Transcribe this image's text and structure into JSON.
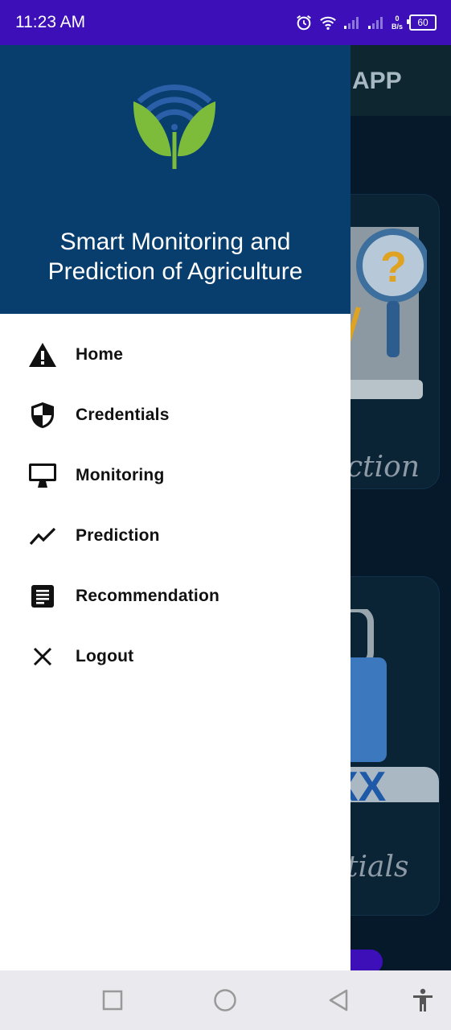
{
  "status_bar": {
    "time": "11:23 AM",
    "net_speed_value": "0",
    "net_speed_unit": "B/s",
    "battery": "60"
  },
  "background_app": {
    "title": "APP",
    "card1_label": "ction",
    "card2_label": "tials"
  },
  "drawer": {
    "header_title_line1": "Smart Monitoring and",
    "header_title_line2": "Prediction of Agriculture",
    "menu": [
      {
        "label": "Home",
        "icon": "warning-icon"
      },
      {
        "label": "Credentials",
        "icon": "shield-icon"
      },
      {
        "label": "Monitoring",
        "icon": "monitor-icon"
      },
      {
        "label": "Prediction",
        "icon": "trending-icon"
      },
      {
        "label": "Recommendation",
        "icon": "document-icon"
      },
      {
        "label": "Logout",
        "icon": "close-icon"
      }
    ]
  },
  "colors": {
    "status_bar": "#3c0fb8",
    "drawer_header": "#073e6e",
    "logo_green": "#7dbb3b",
    "logo_blue": "#2b5fa8"
  }
}
